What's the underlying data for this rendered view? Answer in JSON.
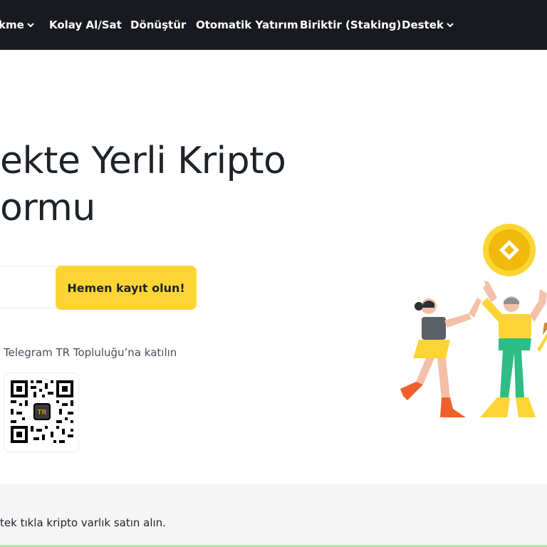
{
  "nav": {
    "items": [
      {
        "label": "kme",
        "dropdown": true
      },
      {
        "label": "Kolay Al/Sat",
        "dropdown": false
      },
      {
        "label": "Dönüştür",
        "dropdown": false
      },
      {
        "label": "Otomatik Yatırım",
        "dropdown": false
      },
      {
        "label": "Biriktir (Staking)",
        "dropdown": false
      },
      {
        "label": "Destek",
        "dropdown": true
      }
    ]
  },
  "hero": {
    "title_line1": "ekte Yerli Kripto",
    "title_line2": "ormu",
    "email_value": "",
    "signup_label": "Hemen kayıt olun!",
    "telegram_text": "Telegram TR Topluluğu’na katılın",
    "qr_badge": "TR"
  },
  "bottom": {
    "text": "tek tıkla kripto varlık satın alın."
  },
  "colors": {
    "nav_bg": "#181a20",
    "accent_yellow": "#fcd535",
    "coin_yellow": "#f0b90b"
  },
  "icons": [
    "chevron-down-icon",
    "qr-code-icon",
    "coin-icon"
  ]
}
